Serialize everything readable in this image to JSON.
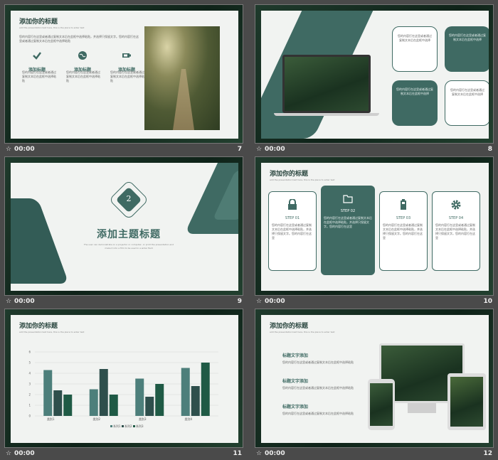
{
  "slides": [
    {
      "number": "7",
      "time": "00:00",
      "title": "添加你的标题",
      "subtitle": "add the presentation text here, this is the place to enter text",
      "intro": "您的内容打在这里或者通过复制文本后在此框中选择粘贴，并选择只保留文字。您的内容打在这里或者通过复制文本后在此框中选择粘贴",
      "items": [
        {
          "icon": "check-icon",
          "label": "添加标题",
          "text": "您的内容打在这里或者通过复制文本后在此框中选择粘贴"
        },
        {
          "icon": "globe-icon",
          "label": "添加标题",
          "text": "您的内容打在这里或者通过复制文本后在此框中选择粘贴"
        },
        {
          "icon": "battery-icon",
          "label": "添加标题",
          "text": "您的内容打在这里或者通过复制文本后在此框中选择粘贴"
        }
      ]
    },
    {
      "number": "8",
      "time": "00:00",
      "boxes": [
        "您的内容打在这里或者通过复制文本后在此框中选择",
        "您的内容打在这里或者通过复制文本后在此框中选择",
        "您的内容打在这里或者通过复制文本后在此框中选择",
        "您的内容打在这里或者通过复制文本后在此框中选择"
      ]
    },
    {
      "number": "9",
      "time": "00:00",
      "badge": "2",
      "heading": "添加主题标题",
      "caption": "The user can demonstrate on a projector or computer, or print the presentation and make it into a film to be used in a wider field"
    },
    {
      "number": "10",
      "time": "00:00",
      "title": "添加你的标题",
      "subtitle": "add the presentation text here, this is the place to enter text",
      "steps": [
        {
          "icon": "lock-icon",
          "label": "STEP 01",
          "text": "您的内容打在这里或者通过复制文本后在此框中选择粘贴，并选择只保留文字。您的内容打在这里"
        },
        {
          "icon": "folder-icon",
          "label": "STEP 02",
          "text": "您的内容打在这里或者通过复制文本后在此框中选择粘贴，并选择只保留文字。您的内容打在这里"
        },
        {
          "icon": "battery-icon",
          "label": "STEP 03",
          "text": "您的内容打在这里或者通过复制文本后在此框中选择粘贴，并选择只保留文字。您的内容打在这里"
        },
        {
          "icon": "gear-icon",
          "label": "STEP 04",
          "text": "您的内容打在这里或者通过复制文本后在此框中选择粘贴，并选择只保留文字。您的内容打在这里"
        }
      ]
    },
    {
      "number": "11",
      "time": "00:00",
      "title": "添加你的标题",
      "subtitle": "add the presentation text here, this is the place to enter text",
      "legend": [
        "系列1",
        "系列2",
        "系列3"
      ]
    },
    {
      "number": "12",
      "time": "00:00",
      "title": "添加你的标题",
      "subtitle": "add the presentation text here, this is the place to enter text",
      "entries": [
        {
          "heading": "标题文字添加",
          "text": "您的内容打在这里或者通过复制文本后在此框中选择粘贴"
        },
        {
          "heading": "标题文字添加",
          "text": "您的内容打在这里或者通过复制文本后在此框中选择粘贴"
        },
        {
          "heading": "标题文字添加",
          "text": "您的内容打在这里或者通过复制文本后在此框中选择粘贴"
        }
      ]
    }
  ],
  "colors": {
    "accent": "#3f6a63",
    "dark_green": "#1f5a45",
    "slate": "#4d7f7b"
  },
  "chart_data": {
    "type": "bar",
    "categories": [
      "类别1",
      "类别2",
      "类别3",
      "类别4"
    ],
    "series": [
      {
        "name": "系列1",
        "values": [
          4.3,
          2.5,
          3.5,
          4.5
        ]
      },
      {
        "name": "系列2",
        "values": [
          2.4,
          4.4,
          1.8,
          2.8
        ]
      },
      {
        "name": "系列3",
        "values": [
          2.0,
          2.0,
          3.0,
          5.0
        ]
      }
    ],
    "yticks": [
      "0",
      "1",
      "2",
      "3",
      "4",
      "5",
      "6"
    ],
    "ylim": [
      0,
      6
    ]
  }
}
